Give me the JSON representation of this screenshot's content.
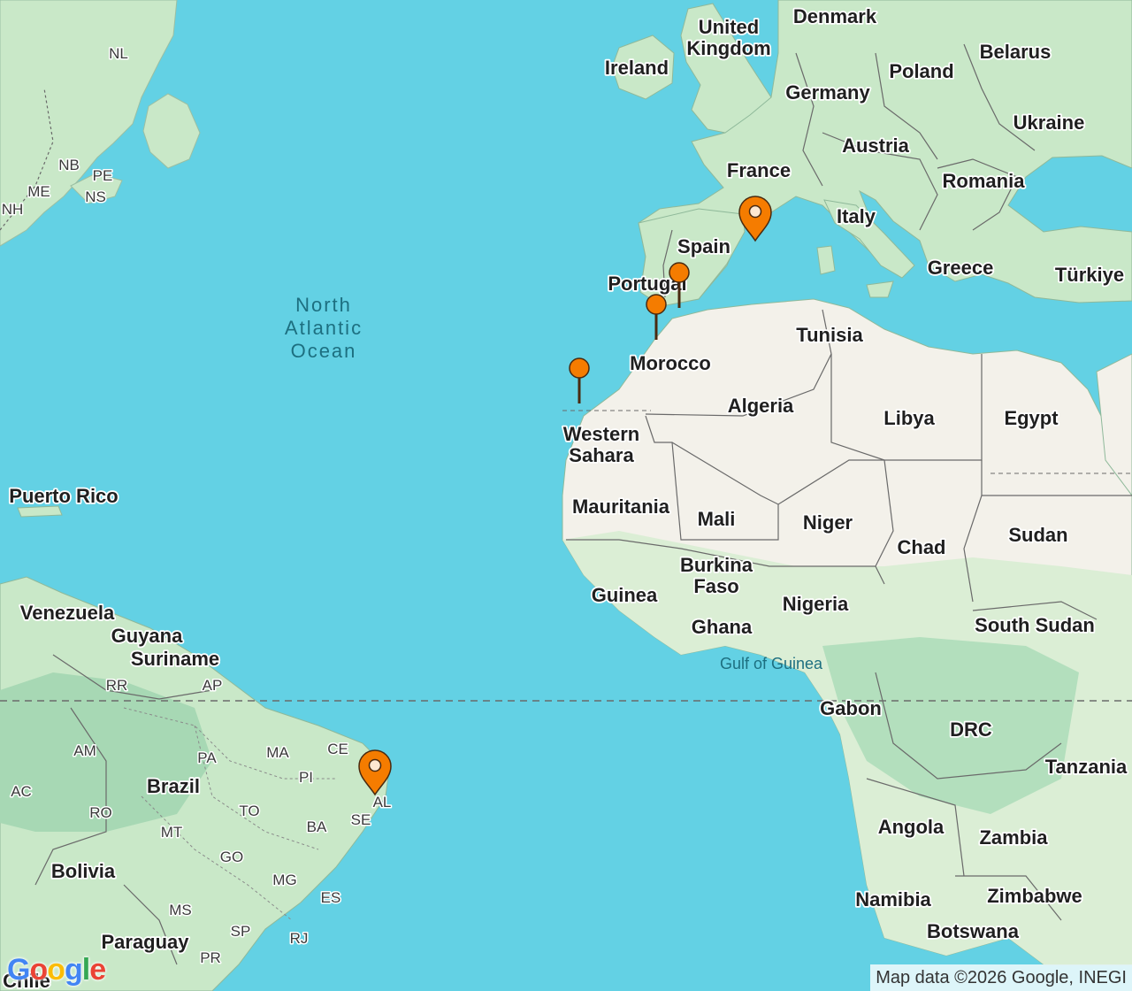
{
  "map": {
    "colors": {
      "water": "#63d1e4",
      "land": "#f3f1ea",
      "green": "#c9e8c8",
      "forest": "#a7d8b4",
      "border": "#5a5a5a",
      "marker": "#f57c00"
    },
    "countries": [
      {
        "id": "united-kingdom",
        "lines": [
          "United",
          "Kingdom"
        ]
      },
      {
        "id": "denmark",
        "lines": [
          "Denmark"
        ]
      },
      {
        "id": "ireland",
        "lines": [
          "Ireland"
        ]
      },
      {
        "id": "belarus",
        "lines": [
          "Belarus"
        ]
      },
      {
        "id": "poland",
        "lines": [
          "Poland"
        ]
      },
      {
        "id": "germany",
        "lines": [
          "Germany"
        ]
      },
      {
        "id": "ukraine",
        "lines": [
          "Ukraine"
        ]
      },
      {
        "id": "austria",
        "lines": [
          "Austria"
        ]
      },
      {
        "id": "france",
        "lines": [
          "France"
        ]
      },
      {
        "id": "romania",
        "lines": [
          "Romania"
        ]
      },
      {
        "id": "italy",
        "lines": [
          "Italy"
        ]
      },
      {
        "id": "spain",
        "lines": [
          "Spain"
        ]
      },
      {
        "id": "portugal",
        "lines": [
          "Portugal"
        ]
      },
      {
        "id": "greece",
        "lines": [
          "Greece"
        ]
      },
      {
        "id": "turkiye",
        "lines": [
          "Türkiye"
        ]
      },
      {
        "id": "tunisia",
        "lines": [
          "Tunisia"
        ]
      },
      {
        "id": "morocco",
        "lines": [
          "Morocco"
        ]
      },
      {
        "id": "algeria",
        "lines": [
          "Algeria"
        ]
      },
      {
        "id": "libya",
        "lines": [
          "Libya"
        ]
      },
      {
        "id": "egypt",
        "lines": [
          "Egypt"
        ]
      },
      {
        "id": "western-sahara",
        "lines": [
          "Western",
          "Sahara"
        ]
      },
      {
        "id": "mauritania",
        "lines": [
          "Mauritania"
        ]
      },
      {
        "id": "mali",
        "lines": [
          "Mali"
        ]
      },
      {
        "id": "niger",
        "lines": [
          "Niger"
        ]
      },
      {
        "id": "chad",
        "lines": [
          "Chad"
        ]
      },
      {
        "id": "sudan",
        "lines": [
          "Sudan"
        ]
      },
      {
        "id": "burkina-faso",
        "lines": [
          "Burkina",
          "Faso"
        ]
      },
      {
        "id": "guinea",
        "lines": [
          "Guinea"
        ]
      },
      {
        "id": "nigeria",
        "lines": [
          "Nigeria"
        ]
      },
      {
        "id": "ghana",
        "lines": [
          "Ghana"
        ]
      },
      {
        "id": "south-sudan",
        "lines": [
          "South Sudan"
        ]
      },
      {
        "id": "gabon",
        "lines": [
          "Gabon"
        ]
      },
      {
        "id": "drc",
        "lines": [
          "DRC"
        ]
      },
      {
        "id": "tanzania",
        "lines": [
          "Tanzania"
        ]
      },
      {
        "id": "angola",
        "lines": [
          "Angola"
        ]
      },
      {
        "id": "zambia",
        "lines": [
          "Zambia"
        ]
      },
      {
        "id": "namibia",
        "lines": [
          "Namibia"
        ]
      },
      {
        "id": "zimbabwe",
        "lines": [
          "Zimbabwe"
        ]
      },
      {
        "id": "botswana",
        "lines": [
          "Botswana"
        ]
      },
      {
        "id": "puerto-rico",
        "lines": [
          "Puerto Rico"
        ]
      },
      {
        "id": "venezuela",
        "lines": [
          "Venezuela"
        ]
      },
      {
        "id": "guyana",
        "lines": [
          "Guyana"
        ]
      },
      {
        "id": "suriname",
        "lines": [
          "Suriname"
        ]
      },
      {
        "id": "brazil",
        "lines": [
          "Brazil"
        ]
      },
      {
        "id": "bolivia",
        "lines": [
          "Bolivia"
        ]
      },
      {
        "id": "paraguay",
        "lines": [
          "Paraguay"
        ]
      },
      {
        "id": "chile",
        "lines": [
          "Chile"
        ]
      }
    ],
    "regions": [
      "NL",
      "NB",
      "PE",
      "ME",
      "NS",
      "NH",
      "RR",
      "AP",
      "AM",
      "PA",
      "MA",
      "CE",
      "PI",
      "AC",
      "RO",
      "MT",
      "TO",
      "BA",
      "SE",
      "AL",
      "GO",
      "MG",
      "ES",
      "MS",
      "SP",
      "RJ",
      "PR"
    ],
    "water_labels": {
      "ocean": [
        "North",
        "Atlantic",
        "Ocean"
      ],
      "gulf": "Gulf of Guinea"
    },
    "markers": [
      {
        "id": "barcelona",
        "type": "selected"
      },
      {
        "id": "seville",
        "type": "pin"
      },
      {
        "id": "tangier",
        "type": "pin"
      },
      {
        "id": "canary-islands",
        "type": "pin"
      },
      {
        "id": "brazil-coast",
        "type": "selected"
      }
    ],
    "attribution": "Map data ©2026 Google, INEGI",
    "logo": "Google"
  }
}
